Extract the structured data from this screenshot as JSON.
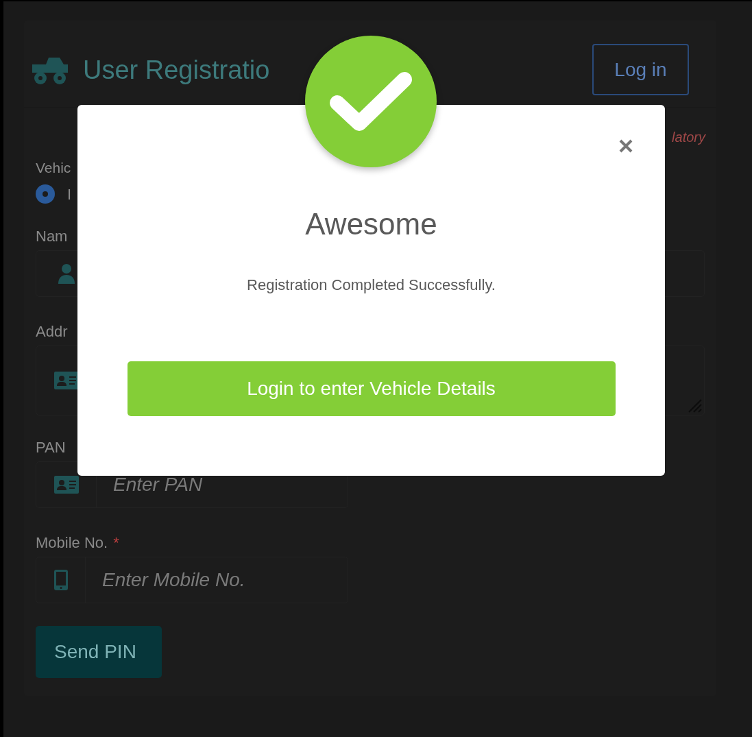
{
  "page": {
    "title": "User Registratio",
    "login_button": "Log in",
    "mandatory_note": "latory",
    "vehicle_label": "Vehic",
    "vehicle_options": [
      {
        "label": "I",
        "selected": true
      }
    ],
    "fields": [
      {
        "label": "Nam",
        "kind": "input"
      },
      {
        "label": "Addr",
        "kind": "textarea"
      },
      {
        "label": "PAN",
        "kind": "input",
        "placeholder": "Enter PAN"
      },
      {
        "label": "Mobile No.",
        "kind": "input",
        "placeholder": "Enter Mobile No.",
        "required_mark": "*"
      }
    ],
    "send_button": "Send PIN"
  },
  "modal": {
    "title": "Awesome",
    "message": "Registration Completed Successfully.",
    "button": "Login to enter Vehicle Details"
  }
}
